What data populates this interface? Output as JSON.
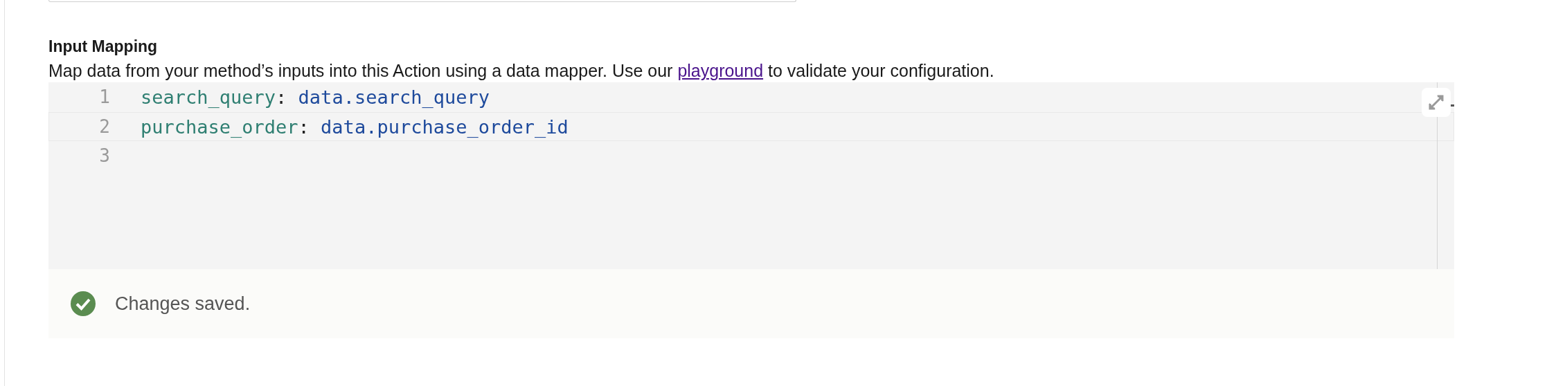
{
  "section": {
    "title": "Input Mapping",
    "description": {
      "before": "Map data from your method’s inputs into this Action using a data mapper. Use our ",
      "link": "playground",
      "after": " to validate your configuration."
    }
  },
  "editor": {
    "lines": [
      {
        "number": "1",
        "active": false,
        "tokens": [
          {
            "kind": "key",
            "text": "search_query"
          },
          {
            "kind": "punct",
            "text": ":"
          },
          {
            "kind": "value",
            "text": "data.search_query"
          }
        ]
      },
      {
        "number": "2",
        "active": true,
        "tokens": [
          {
            "kind": "key",
            "text": "purchase_order"
          },
          {
            "kind": "punct",
            "text": ":"
          },
          {
            "kind": "value",
            "text": "data.purchase_order_id"
          }
        ]
      },
      {
        "number": "3",
        "active": false
      }
    ]
  },
  "status": {
    "kind": "success",
    "message": "Changes saved."
  }
}
